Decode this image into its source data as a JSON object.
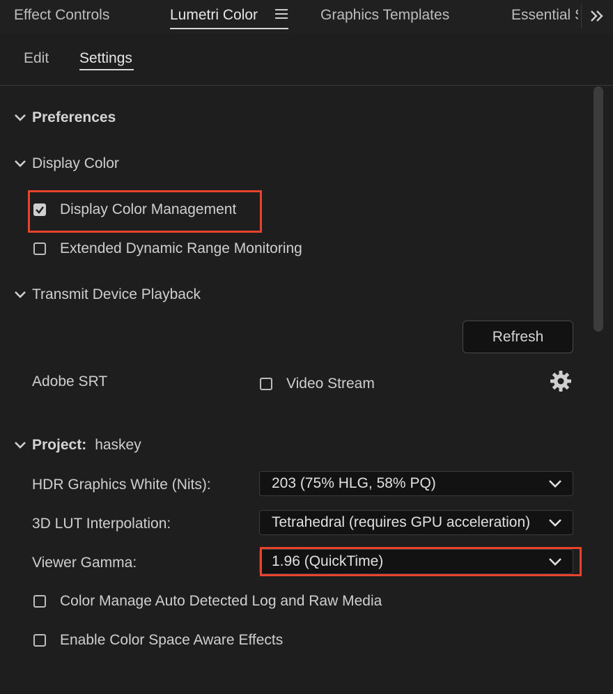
{
  "tabs": [
    {
      "label": "Effect Controls"
    },
    {
      "label": "Lumetri Color"
    },
    {
      "label": "Graphics Templates"
    },
    {
      "label": "Essential S"
    }
  ],
  "subtabs": [
    {
      "label": "Edit"
    },
    {
      "label": "Settings"
    }
  ],
  "sections": {
    "preferences": "Preferences",
    "display_color": "Display Color",
    "transmit": "Transmit Device Playback",
    "project_label": "Project:",
    "project_name": "haskey"
  },
  "checkboxes": {
    "display_color_mgmt": {
      "label": "Display Color Management",
      "checked": true
    },
    "edr_monitoring": {
      "label": "Extended Dynamic Range Monitoring",
      "checked": false
    },
    "video_stream": {
      "label": "Video Stream",
      "checked": false
    },
    "auto_detect_log": {
      "label": "Color Manage Auto Detected Log and Raw Media",
      "checked": false
    },
    "color_space_aware": {
      "label": "Enable Color Space Aware Effects",
      "checked": false
    }
  },
  "transmit": {
    "refresh_label": "Refresh",
    "adobe_srt_label": "Adobe SRT"
  },
  "project_fields": {
    "hdr_white": {
      "label": "HDR Graphics White (Nits):",
      "value": "203 (75% HLG, 58% PQ)"
    },
    "lut_interp": {
      "label": "3D LUT Interpolation:",
      "value": "Tetrahedral (requires GPU acceleration)"
    },
    "viewer_gamma": {
      "label": "Viewer Gamma:",
      "value": "1.96 (QuickTime)"
    }
  },
  "colors": {
    "background": "#1e1e1e",
    "highlight": "#e8432d",
    "text": "#cfcfcf"
  },
  "icons": {
    "menu": "hamburger-icon",
    "overflow": "double-chevron-right-icon",
    "caret": "chevron-down-icon",
    "gear": "gear-icon"
  }
}
